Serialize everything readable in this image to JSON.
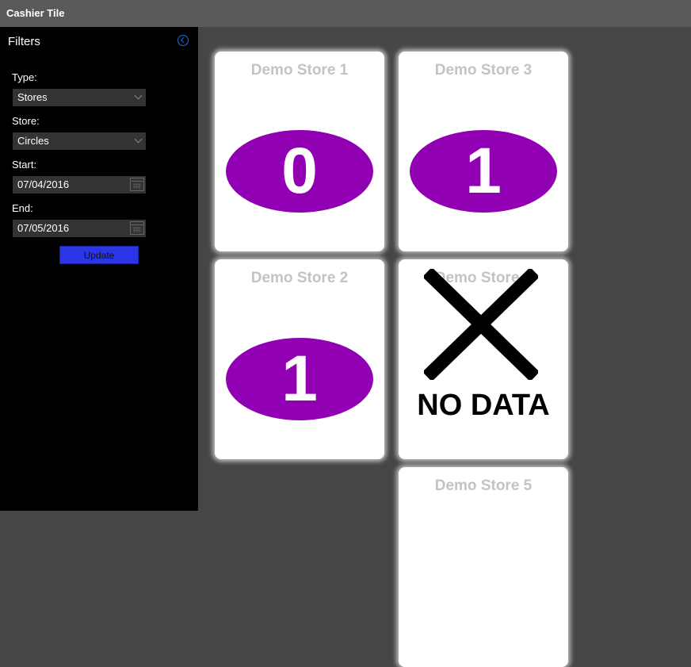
{
  "app": {
    "title": "Cashier Tile"
  },
  "filters": {
    "title": "Filters",
    "type": {
      "label": "Type:",
      "value": "Stores"
    },
    "store": {
      "label": "Store:",
      "value": "Circles"
    },
    "start": {
      "label": "Start:",
      "value": "07/04/2016"
    },
    "end": {
      "label": "End:",
      "value": "07/05/2016"
    },
    "update_label": "Update"
  },
  "tiles": [
    {
      "name": "Demo Store 1",
      "value": "0"
    },
    {
      "name": "Demo Store 3",
      "value": "1"
    },
    {
      "name": "Demo Store 2",
      "value": "1"
    },
    {
      "name": "Demo Store 4",
      "no_data_text": "NO DATA"
    },
    {
      "name": "Demo Store 5"
    }
  ],
  "colors": {
    "accent": "#9200b4",
    "button": "#2a35e6",
    "collapse_icon": "#1e6fd9"
  }
}
